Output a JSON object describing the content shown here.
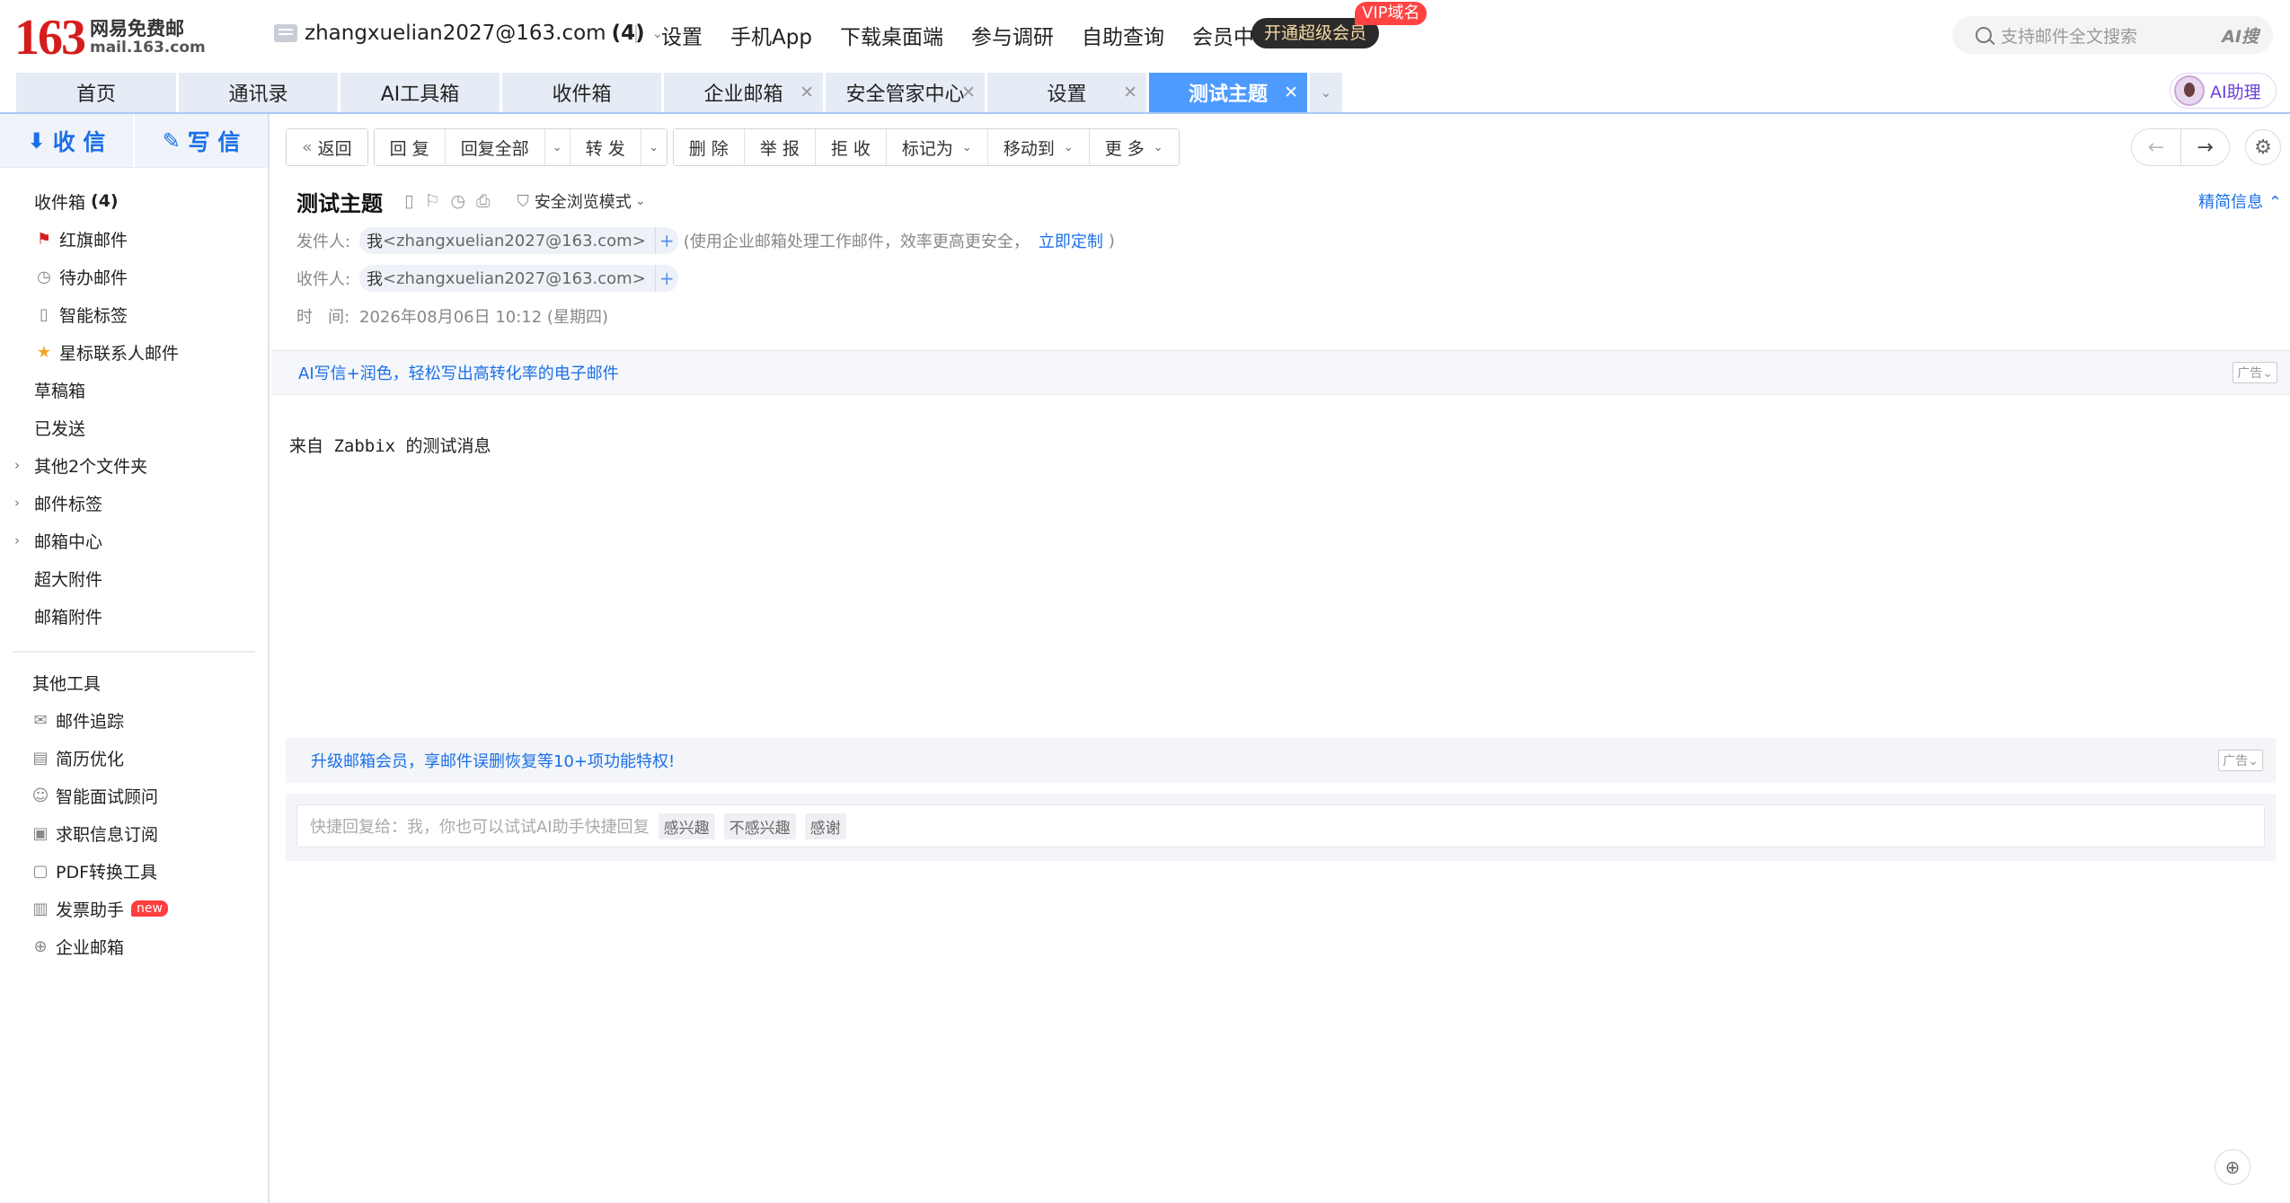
{
  "logo": {
    "number": "163",
    "line1": "网易免费邮",
    "line2": "mail.163.com"
  },
  "account": {
    "email": "zhangxuelian2027@163.com",
    "count": "(4)"
  },
  "topnav": [
    "设置",
    "手机App",
    "下载桌面端",
    "参与调研",
    "自助查询",
    "会员中心"
  ],
  "vip": {
    "button": "开通超级会员",
    "tag": "VIP域名"
  },
  "search": {
    "placeholder": "支持邮件全文搜索",
    "ai": "AI搜"
  },
  "tabs": [
    {
      "label": "首页",
      "closable": false
    },
    {
      "label": "通讯录",
      "closable": false
    },
    {
      "label": "AI工具箱",
      "closable": false
    },
    {
      "label": "收件箱",
      "closable": false
    },
    {
      "label": "企业邮箱",
      "closable": true
    },
    {
      "label": "安全管家中心",
      "closable": true
    },
    {
      "label": "设置",
      "closable": true
    },
    {
      "label": "测试主题",
      "closable": true,
      "active": true
    }
  ],
  "ai_assistant": "AI助理",
  "sidebar": {
    "receive": "收 信",
    "write": "写 信",
    "items": [
      {
        "label": "收件箱",
        "count": "(4)",
        "icon": ""
      },
      {
        "label": "红旗邮件",
        "icon": "red-flag-icon"
      },
      {
        "label": "待办邮件",
        "icon": "clock-icon"
      },
      {
        "label": "智能标签",
        "icon": "bookmark-icon"
      },
      {
        "label": "星标联系人邮件",
        "icon": "star-icon"
      },
      {
        "label": "草稿箱",
        "icon": ""
      },
      {
        "label": "已发送",
        "icon": ""
      },
      {
        "label": "其他2个文件夹",
        "arrow": true
      },
      {
        "label": "邮件标签",
        "arrow": true
      },
      {
        "label": "邮箱中心",
        "arrow": true
      },
      {
        "label": "超大附件"
      },
      {
        "label": "邮箱附件"
      }
    ],
    "tools_title": "其他工具",
    "tools": [
      {
        "label": "邮件追踪",
        "icon": "mail-track-icon"
      },
      {
        "label": "简历优化",
        "icon": "resume-icon"
      },
      {
        "label": "智能面试顾问",
        "icon": "interview-icon"
      },
      {
        "label": "求职信息订阅",
        "icon": "briefcase-icon"
      },
      {
        "label": "PDF转换工具",
        "icon": "pdf-icon"
      },
      {
        "label": "发票助手",
        "icon": "invoice-icon",
        "badge": "new"
      },
      {
        "label": "企业邮箱",
        "icon": "globe-icon"
      }
    ]
  },
  "toolbar": {
    "back": "返回",
    "reply": "回 复",
    "reply_all": "回复全部",
    "forward": "转 发",
    "delete": "删 除",
    "report": "举 报",
    "reject": "拒 收",
    "mark_as": "标记为",
    "move_to": "移动到",
    "more": "更 多"
  },
  "mail": {
    "subject": "测试主题",
    "safe_mode": "安全浏览模式",
    "brief_info": "精简信息",
    "from_label": "发件人:",
    "from_name": "我",
    "from_email": "<zhangxuelian2027@163.com>",
    "from_note": "(使用企业邮箱处理工作邮件，效率更高更安全，",
    "from_link": "立即定制",
    "from_note_end": ")",
    "to_label": "收件人:",
    "to_name": "我",
    "to_email": "<zhangxuelian2027@163.com>",
    "time_label": "时   间:",
    "time": "2026年08月06日 10:12 (星期四)",
    "ad_text": "AI写信+润色，轻松写出高转化率的电子邮件",
    "ad_tag": "广告",
    "body": "来自 Zabbix 的测试消息",
    "promo": "升级邮箱会员，享邮件误删恢复等10+项功能特权!",
    "quick_reply": "快捷回复给：我，你也可以试试AI助手快捷回复",
    "quick_options": [
      "感兴趣",
      "不感兴趣",
      "感谢"
    ]
  },
  "colors": {
    "accent": "#1b6fe8",
    "active_tab": "#4e9bff",
    "logo_red": "#d61d1d"
  }
}
